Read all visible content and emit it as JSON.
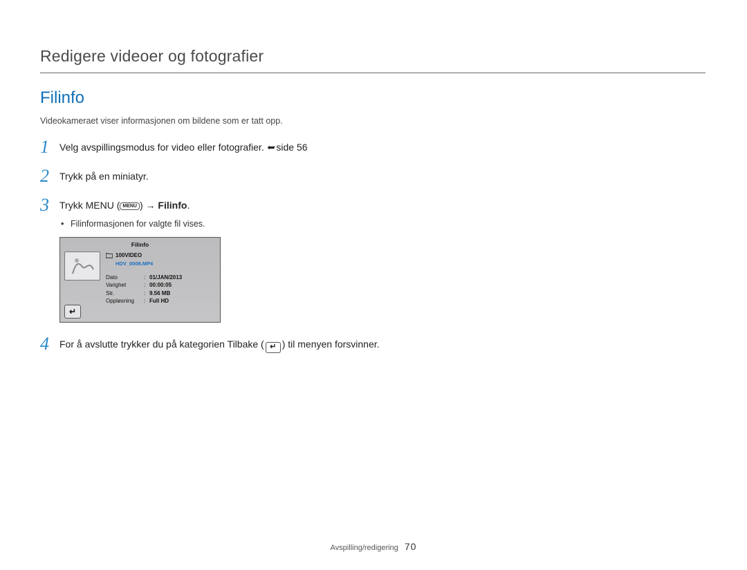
{
  "header": {
    "section_title": "Redigere videoer og fotografier",
    "subsection_title": "Filinfo",
    "intro": "Videokameraet viser informasjonen om bildene som er tatt opp."
  },
  "steps": {
    "s1_num": "1",
    "s1_text_a": "Velg avspillingsmodus for video eller fotografier. ",
    "s1_pageref": "side 56",
    "s2_num": "2",
    "s2_text": "Trykk på en miniatyr.",
    "s3_num": "3",
    "s3_text_a": "Trykk MENU (",
    "s3_menu_chip": "MENU",
    "s3_text_b": ") ",
    "s3_arrow": "→",
    "s3_bold": " Filinfo",
    "s3_text_c": ".",
    "s3_bullet": "Filinformasjonen for valgte fil vises.",
    "s4_num": "4",
    "s4_text_a": "For å avslutte trykker du på kategorien Tilbake (",
    "s4_back_glyph": "↵",
    "s4_text_b": ") til menyen forsvinner."
  },
  "lcd": {
    "title": "Filinfo",
    "folder": "100VIDEO",
    "filename": "HDV_0008.MP4",
    "rows": [
      {
        "label": "Dato",
        "value": "01/JAN/2013"
      },
      {
        "label": "Varighet",
        "value": "00:00:05"
      },
      {
        "label": "Str.",
        "value": "9.56 MB"
      },
      {
        "label": "Oppløsning",
        "value": "Full HD"
      }
    ],
    "back_glyph": "↵"
  },
  "footer": {
    "chapter": "Avspilling/redigering",
    "page": "70"
  }
}
